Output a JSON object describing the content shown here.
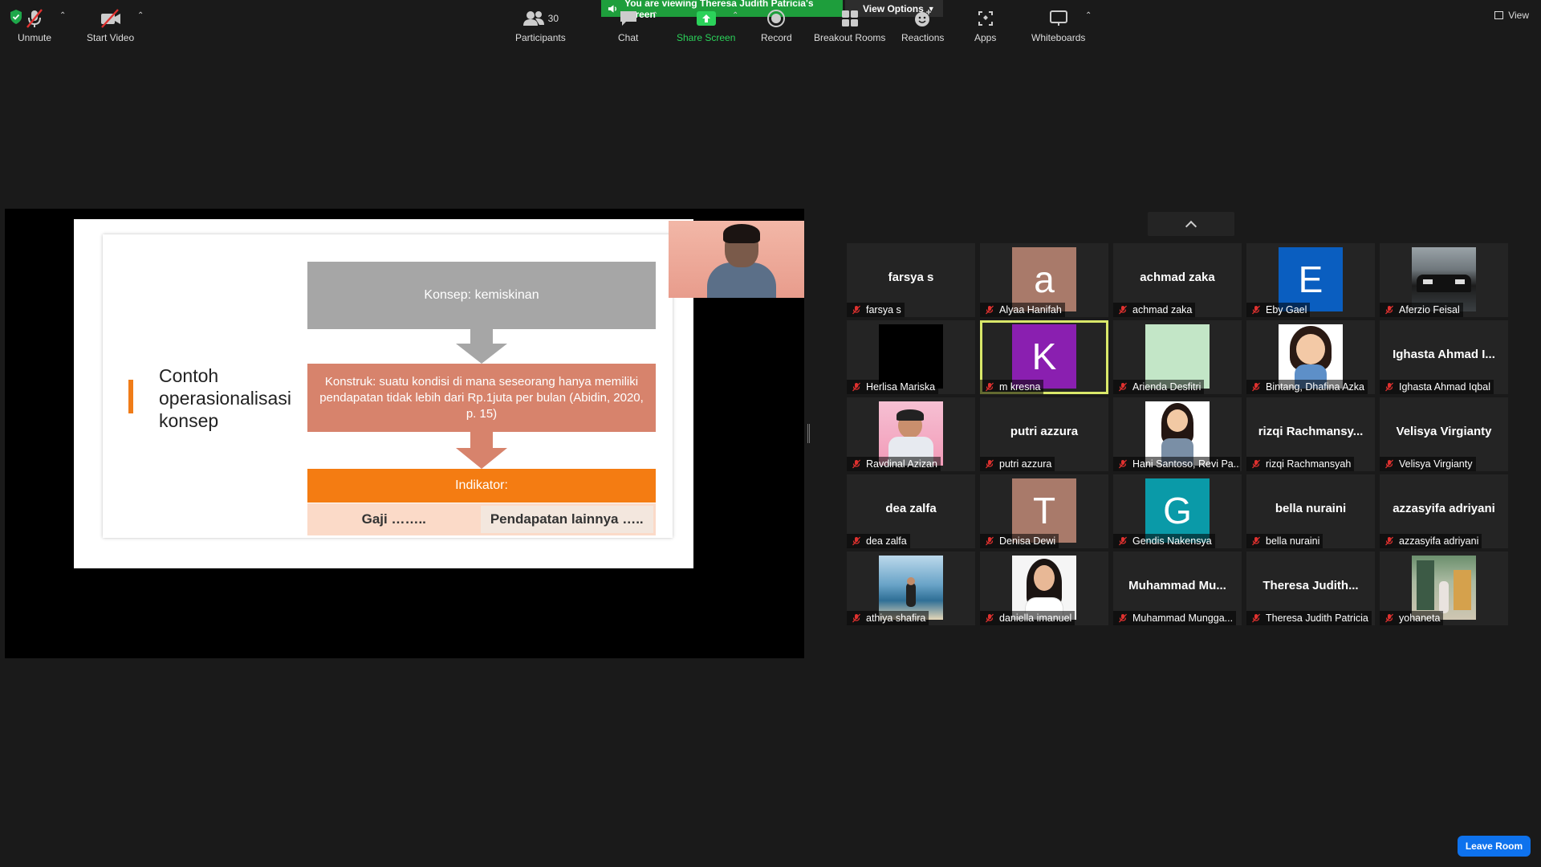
{
  "banner": {
    "viewing_text": "You are viewing Theresa Judith Patricia's screen",
    "view_options_label": "View Options"
  },
  "view_label": "View",
  "slide": {
    "title": "Contoh operasionalisasi konsep",
    "konsep": "Konsep: kemiskinan",
    "konstruk": "Konstruk: suatu kondisi di mana seseorang hanya memiliki pendapatan tidak lebih dari Rp.1juta per bulan (Abidin, 2020, p. 15)",
    "indikator": "Indikator:",
    "item1": "Gaji ……..",
    "item2": "Pendapatan lainnya ….."
  },
  "participants": [
    {
      "label": "farsya s",
      "big": "farsya s",
      "type": "name"
    },
    {
      "label": "Alyaa Hanifah",
      "letter": "a",
      "color": "#a97a6a",
      "type": "letter"
    },
    {
      "label": "achmad zaka",
      "big": "achmad zaka",
      "type": "name"
    },
    {
      "label": "Eby Gael",
      "letter": "E",
      "color": "#0a5ec0",
      "type": "letter"
    },
    {
      "label": "Aferzio Feisal",
      "type": "photo",
      "photo": "car"
    },
    {
      "label": "Herlisa Mariska",
      "type": "photo",
      "photo": "black"
    },
    {
      "label": "m kresna",
      "letter": "K",
      "color": "#8a1fb0",
      "type": "letter",
      "active": true
    },
    {
      "label": "Arienda Desfitri",
      "type": "photo",
      "photo": "mint"
    },
    {
      "label": "Bintang, Dhafina Azka",
      "type": "photo",
      "photo": "cartoon"
    },
    {
      "label": "Ighasta Ahmad Iqbal",
      "big": "Ighasta Ahmad I...",
      "type": "name"
    },
    {
      "label": "Ravdinal Azizan",
      "type": "photo",
      "photo": "pink"
    },
    {
      "label": "putri azzura",
      "big": "putri azzura",
      "type": "name"
    },
    {
      "label": "Hani Santoso, Revi Pa...",
      "type": "photo",
      "photo": "girl"
    },
    {
      "label": "rizqi Rachmansyah",
      "big": "rizqi  Rachmansy...",
      "type": "name"
    },
    {
      "label": "Velisya Virgianty",
      "big": "Velisya Virgianty",
      "type": "name"
    },
    {
      "label": "dea zalfa",
      "big": "dea zalfa",
      "type": "name"
    },
    {
      "label": "Denisa Dewi",
      "letter": "T",
      "color": "#a97a6a",
      "type": "letter"
    },
    {
      "label": "Gendis Nakensya",
      "letter": "G",
      "color": "#0a9aa8",
      "type": "letter"
    },
    {
      "label": "bella nuraini",
      "big": "bella nuraini",
      "type": "name"
    },
    {
      "label": "azzasyifa adriyani",
      "big": "azzasyifa adriyani",
      "type": "name"
    },
    {
      "label": "athiya shafira",
      "type": "photo",
      "photo": "beach"
    },
    {
      "label": "daniella imanuel",
      "type": "photo",
      "photo": "portrait"
    },
    {
      "label": "Muhammad Mungga...",
      "big": "Muhammad  Mu...",
      "type": "name"
    },
    {
      "label": "Theresa Judith Patricia",
      "big": "Theresa  Judith...",
      "type": "name"
    },
    {
      "label": "yohaneta",
      "type": "photo",
      "photo": "street"
    }
  ],
  "toolbar": {
    "unmute": "Unmute",
    "start_video": "Start Video",
    "participants": "Participants",
    "participants_count": "30",
    "chat": "Chat",
    "share_screen": "Share Screen",
    "record": "Record",
    "breakout": "Breakout Rooms",
    "reactions": "Reactions",
    "apps": "Apps",
    "whiteboards": "Whiteboards",
    "leave": "Leave Room"
  },
  "colors": {
    "banner_green": "#1e9e3c",
    "active_speaker": "#d9e86a",
    "leave_blue": "#0e72ed",
    "share_green": "#2bd25a",
    "muted_red": "#e0312f"
  }
}
